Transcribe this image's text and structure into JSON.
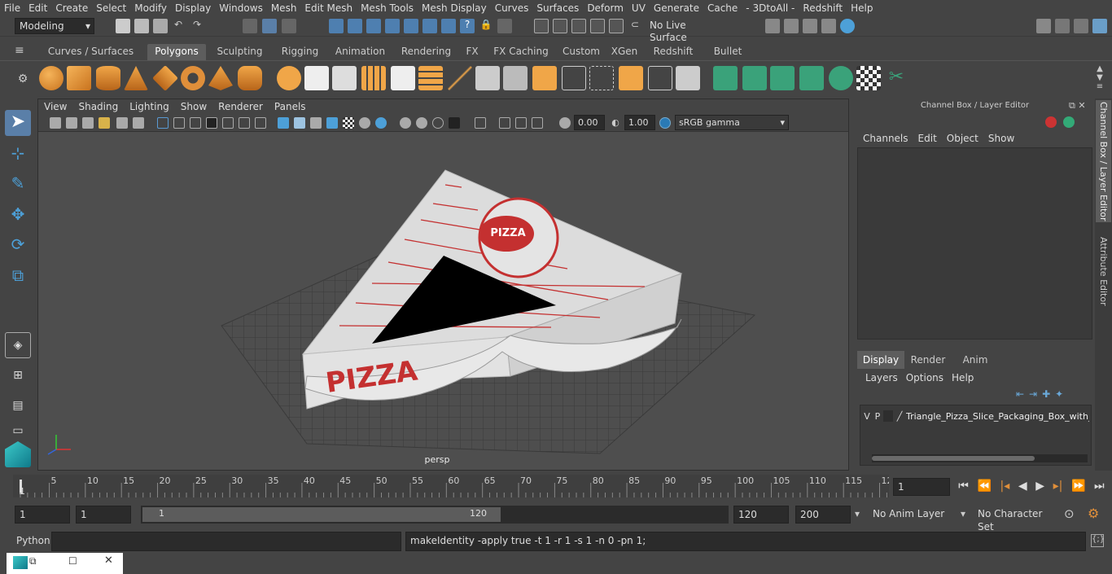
{
  "menu": [
    "File",
    "Edit",
    "Create",
    "Select",
    "Modify",
    "Display",
    "Windows",
    "Mesh",
    "Edit Mesh",
    "Mesh Tools",
    "Mesh Display",
    "Curves",
    "Surfaces",
    "Deform",
    "UV",
    "Generate",
    "Cache",
    "- 3DtoAll -",
    "Redshift",
    "Help"
  ],
  "mode_select": "Modeling",
  "live_surface": "No Live Surface",
  "shelf_tabs": [
    "Curves / Surfaces",
    "Polygons",
    "Sculpting",
    "Rigging",
    "Animation",
    "Rendering",
    "FX",
    "FX Caching",
    "Custom",
    "XGen",
    "Redshift",
    "Bullet"
  ],
  "active_shelf_tab": "Polygons",
  "viewport": {
    "menu": [
      "View",
      "Shading",
      "Lighting",
      "Show",
      "Renderer",
      "Panels"
    ],
    "exposure": "0.00",
    "gamma": "1.00",
    "color_space": "sRGB gamma",
    "camera_label": "persp",
    "box_text": "PIZZA",
    "lid_text": "PIZZA"
  },
  "channel_box": {
    "title": "Channel Box / Layer Editor",
    "menu": [
      "Channels",
      "Edit",
      "Object",
      "Show"
    ],
    "layer_tabs": [
      "Display",
      "Render",
      "Anim"
    ],
    "active_layer_tab": "Display",
    "layer_menu": [
      "Layers",
      "Options",
      "Help"
    ],
    "layer": {
      "v": "V",
      "p": "P",
      "name": "Triangle_Pizza_Slice_Packaging_Box_with_W"
    }
  },
  "side_tabs": [
    "Channel Box / Layer Editor",
    "Attribute Editor"
  ],
  "timeline": {
    "ticks": [
      "5",
      "10",
      "15",
      "20",
      "25",
      "30",
      "35",
      "40",
      "45",
      "50",
      "55",
      "60",
      "65",
      "70",
      "75",
      "80",
      "85",
      "90",
      "95",
      "100",
      "105",
      "110",
      "115",
      "12"
    ],
    "start_label": "1",
    "current_frame": "1"
  },
  "range": {
    "start": "1",
    "playback_start": "1",
    "slider_start": "1",
    "slider_end": "120",
    "playback_end": "120",
    "end": "200",
    "anim_layer": "No Anim Layer",
    "character_set": "No Character Set"
  },
  "command": {
    "language": "Python",
    "output": "makeIdentity -apply true -t 1 -r 1 -s 1 -n 0 -pn 1;"
  },
  "colors": {
    "accent": "#5d9ed4",
    "active_tool": "#5a7fa8",
    "shelf_green": "#3aa27a"
  }
}
